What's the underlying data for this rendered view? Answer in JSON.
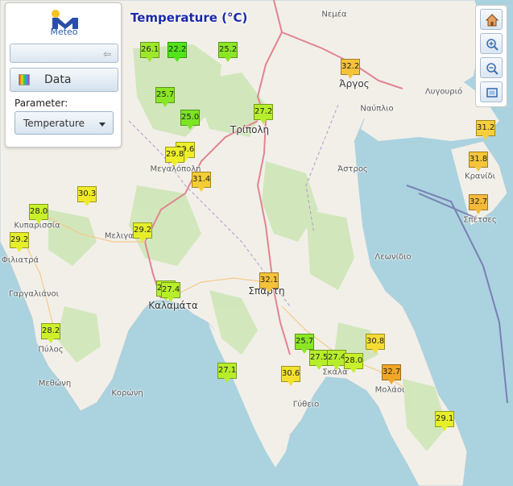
{
  "map_title": "Temperature (°C)",
  "panel": {
    "logo_text": "Meteo",
    "data_label": "Data",
    "parameter_label": "Parameter:",
    "parameter_value": "Temperature"
  },
  "toolbar": [
    "home-icon",
    "zoom-in-icon",
    "zoom-out-icon",
    "full-extent-icon"
  ],
  "colors": {
    "green": "#52e41a",
    "yellow_green": "#a8ee2a",
    "yellow": "#f1ee25",
    "orange": "#f5c23a",
    "dark_orange": "#f0a626",
    "title": "#1b2aa8"
  },
  "places": [
    {
      "name": "Νεμέα",
      "big": false
    },
    {
      "name": "Άργος",
      "big": true
    },
    {
      "name": "Ναύπλιο",
      "big": false
    },
    {
      "name": "Λυγουριό",
      "big": false
    },
    {
      "name": "Τρίπολη",
      "big": true
    },
    {
      "name": "Μεγαλόπολη",
      "big": false
    },
    {
      "name": "Άστρος",
      "big": false
    },
    {
      "name": "Κρανίδι",
      "big": false
    },
    {
      "name": "Σπέτσες",
      "big": false
    },
    {
      "name": "Κυπαρισσία",
      "big": false
    },
    {
      "name": "Μελιγαλάς",
      "big": false
    },
    {
      "name": "Φιλιατρά",
      "big": false
    },
    {
      "name": "Λεωνίδιο",
      "big": false
    },
    {
      "name": "Γαργαλιάνοι",
      "big": false
    },
    {
      "name": "Σπάρτη",
      "big": true
    },
    {
      "name": "Καλαμάτα",
      "big": true
    },
    {
      "name": "Πύλος",
      "big": false
    },
    {
      "name": "Σκάλα",
      "big": false
    },
    {
      "name": "Μεθώνη",
      "big": false
    },
    {
      "name": "Κορώνη",
      "big": false
    },
    {
      "name": "Μολάοι",
      "big": false
    },
    {
      "name": "Γύθειο",
      "big": false
    }
  ],
  "stations": [
    {
      "value": "26.1",
      "color": "#9de82b"
    },
    {
      "value": "22.2",
      "color": "#52e41a"
    },
    {
      "value": "25.2",
      "color": "#8be625"
    },
    {
      "value": "32.2",
      "color": "#f5c23a"
    },
    {
      "value": "25.7",
      "color": "#8be625"
    },
    {
      "value": "27.2",
      "color": "#b6ee2c"
    },
    {
      "value": "25.0",
      "color": "#7de425"
    },
    {
      "value": "31.2",
      "color": "#f5d038"
    },
    {
      "value": "29.6",
      "color": "#eeee2a"
    },
    {
      "value": "29.8",
      "color": "#eeee2a"
    },
    {
      "value": "31.8",
      "color": "#f5c53a"
    },
    {
      "value": "31.4",
      "color": "#f3cd36"
    },
    {
      "value": "30.3",
      "color": "#f1ea2a"
    },
    {
      "value": "32.7",
      "color": "#f5b93a"
    },
    {
      "value": "28.0",
      "color": "#c8f02c"
    },
    {
      "value": "29.2",
      "color": "#e6ee2a"
    },
    {
      "value": "29.2",
      "color": "#e6ee2a"
    },
    {
      "value": "32.1",
      "color": "#f5c23a"
    },
    {
      "value": "27.4",
      "color": "#b6ee2c"
    },
    {
      "value": "27.4",
      "color": "#b6ee2c"
    },
    {
      "value": "28.2",
      "color": "#cef02c"
    },
    {
      "value": "25.7",
      "color": "#8be625"
    },
    {
      "value": "30.8",
      "color": "#f5dc32"
    },
    {
      "value": "27.5",
      "color": "#b6ee2c"
    },
    {
      "value": "27.4",
      "color": "#b6ee2c"
    },
    {
      "value": "28.0",
      "color": "#c8f02c"
    },
    {
      "value": "27.1",
      "color": "#b6ee2c"
    },
    {
      "value": "30.6",
      "color": "#f3e030"
    },
    {
      "value": "32.7",
      "color": "#f0a626"
    },
    {
      "value": "29.1",
      "color": "#e6ee2a"
    }
  ]
}
